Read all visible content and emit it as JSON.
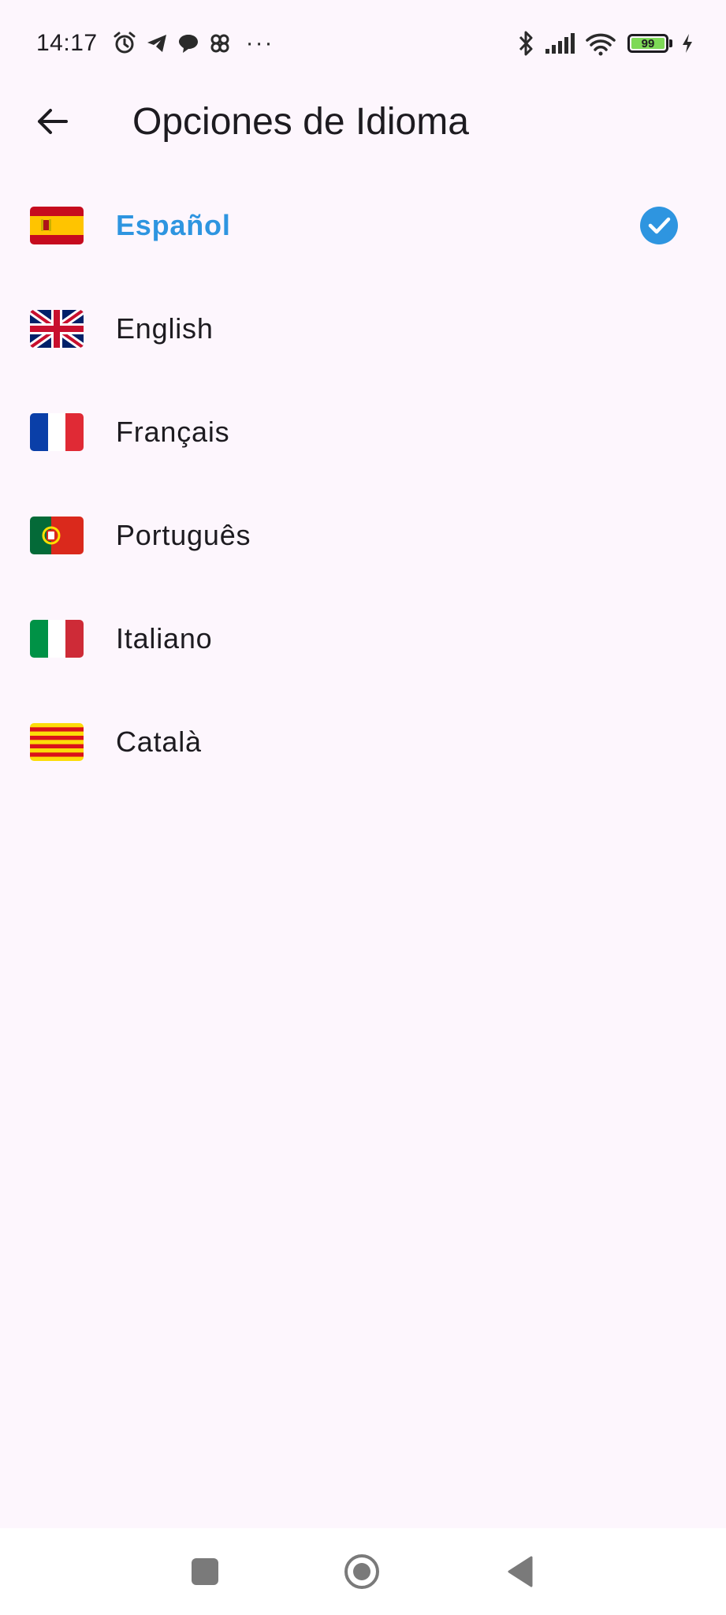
{
  "status_bar": {
    "time": "14:17",
    "more": "···",
    "battery_level": "99",
    "icons": [
      "alarm-icon",
      "telegram-icon",
      "chat-icon",
      "pinwheel-icon",
      "bluetooth-icon",
      "signal-icon",
      "wifi-icon",
      "battery-icon",
      "charging-icon"
    ]
  },
  "app_bar": {
    "title": "Opciones de Idioma",
    "back_icon": "arrow-left-icon"
  },
  "languages": [
    {
      "label": "Español",
      "flag": "spain-flag",
      "selected": true
    },
    {
      "label": "English",
      "flag": "uk-flag",
      "selected": false
    },
    {
      "label": "Français",
      "flag": "france-flag",
      "selected": false
    },
    {
      "label": "Português",
      "flag": "portugal-flag",
      "selected": false
    },
    {
      "label": "Italiano",
      "flag": "italy-flag",
      "selected": false
    },
    {
      "label": "Català",
      "flag": "catalonia-flag",
      "selected": false
    }
  ],
  "colors": {
    "background": "#fdf6fd",
    "accent": "#2e95e0",
    "text": "#1d1b20"
  },
  "nav_bar": {
    "icons": [
      "recents-square-icon",
      "home-circle-icon",
      "back-triangle-icon"
    ]
  }
}
